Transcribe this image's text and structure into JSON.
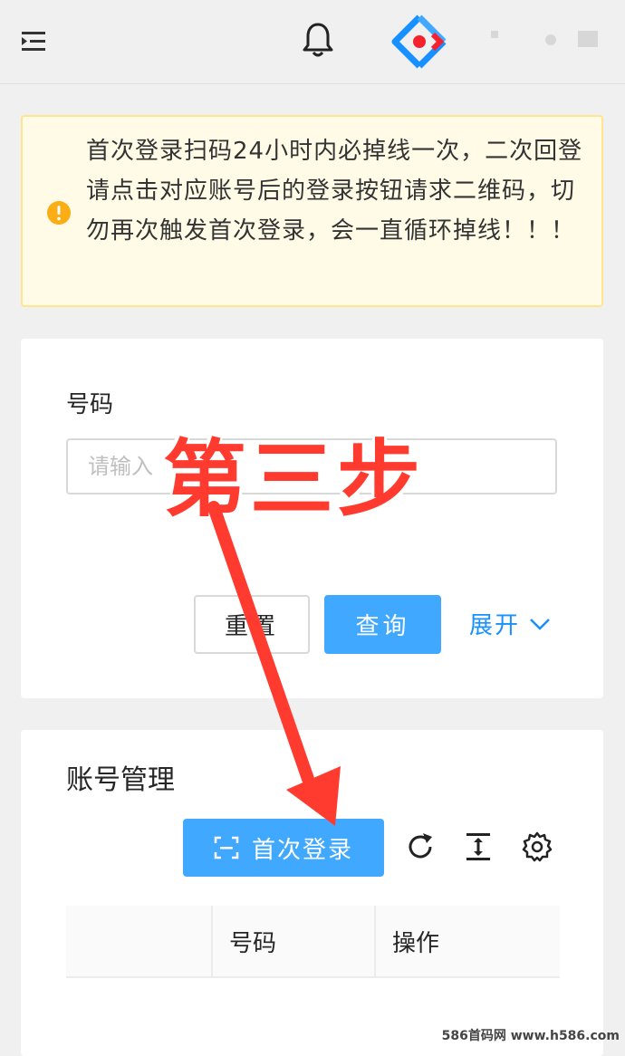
{
  "header": {
    "menu_icon": "menu-fold-icon",
    "bell_icon": "bell-icon",
    "logo": "react-logo",
    "colors": {
      "logo_blue": "#1890ff",
      "logo_red": "#f5222d"
    }
  },
  "alert": {
    "icon": "exclamation-circle-icon",
    "text": "首次登录扫码24小时内必掉线一次，二次回登请点击对应账号后的登录按钮请求二维码，切勿再次触发首次登录，会一直循环掉线！！！",
    "colors": {
      "background": "#fffbe6",
      "border": "#ffe58f",
      "icon": "#faad14"
    }
  },
  "search_form": {
    "field_label": "号码",
    "field_placeholder": "请输入",
    "reset_label": "重置",
    "query_label": "查询",
    "expand_label": "展开",
    "colors": {
      "primary": "#40a9ff",
      "link": "#1890ff"
    }
  },
  "account_list": {
    "title": "账号管理",
    "first_login_label": "首次登录",
    "toolbar_icons": [
      "reload-icon",
      "column-height-icon",
      "setting-icon"
    ],
    "table": {
      "columns": [
        "",
        "号码",
        "操作"
      ]
    }
  },
  "overlay": {
    "step_text": "第三步",
    "color": "#ff3b30"
  },
  "watermark": "586首码网 www.h586.com"
}
